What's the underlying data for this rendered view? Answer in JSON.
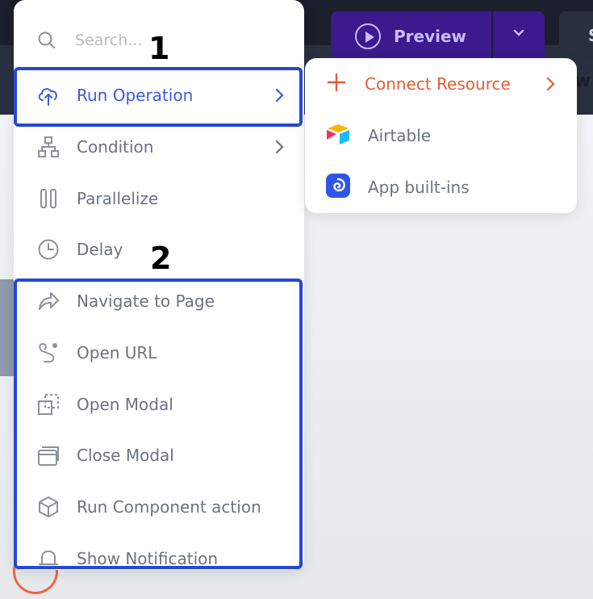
{
  "topbar": {
    "preview_label": "Preview",
    "right_button_text": "S",
    "right_tab_text": "w"
  },
  "search": {
    "placeholder": "Search..."
  },
  "menu": {
    "items": [
      {
        "label": "Run Operation",
        "icon": "upload-cloud-icon",
        "has_submenu": true
      },
      {
        "label": "Condition",
        "icon": "hierarchy-icon",
        "has_submenu": true
      },
      {
        "label": "Parallelize",
        "icon": "parallel-bars-icon",
        "has_submenu": false
      },
      {
        "label": "Delay",
        "icon": "clock-icon",
        "has_submenu": false
      },
      {
        "label": "Navigate to Page",
        "icon": "share-arrow-icon",
        "has_submenu": false
      },
      {
        "label": "Open URL",
        "icon": "route-icon",
        "has_submenu": false
      },
      {
        "label": "Open Modal",
        "icon": "open-modal-icon",
        "has_submenu": false
      },
      {
        "label": "Close Modal",
        "icon": "close-modal-icon",
        "has_submenu": false
      },
      {
        "label": "Run Component action",
        "icon": "cube-icon",
        "has_submenu": false
      },
      {
        "label": "Show Notification",
        "icon": "bell-icon",
        "has_submenu": false
      }
    ]
  },
  "submenu": {
    "items": [
      {
        "label": "Connect Resource",
        "icon": "plus-icon"
      },
      {
        "label": "Airtable",
        "icon": "airtable-logo-icon"
      },
      {
        "label": "App built-ins",
        "icon": "app-builtins-icon"
      }
    ]
  },
  "markers": {
    "one": "1",
    "two": "2"
  },
  "colors": {
    "accent_blue": "#3b5bdb",
    "highlight_blue": "#2348d8",
    "accent_orange": "#e35d35",
    "text_gray": "#6b7280",
    "preview_purple": "#3a1a8c"
  }
}
